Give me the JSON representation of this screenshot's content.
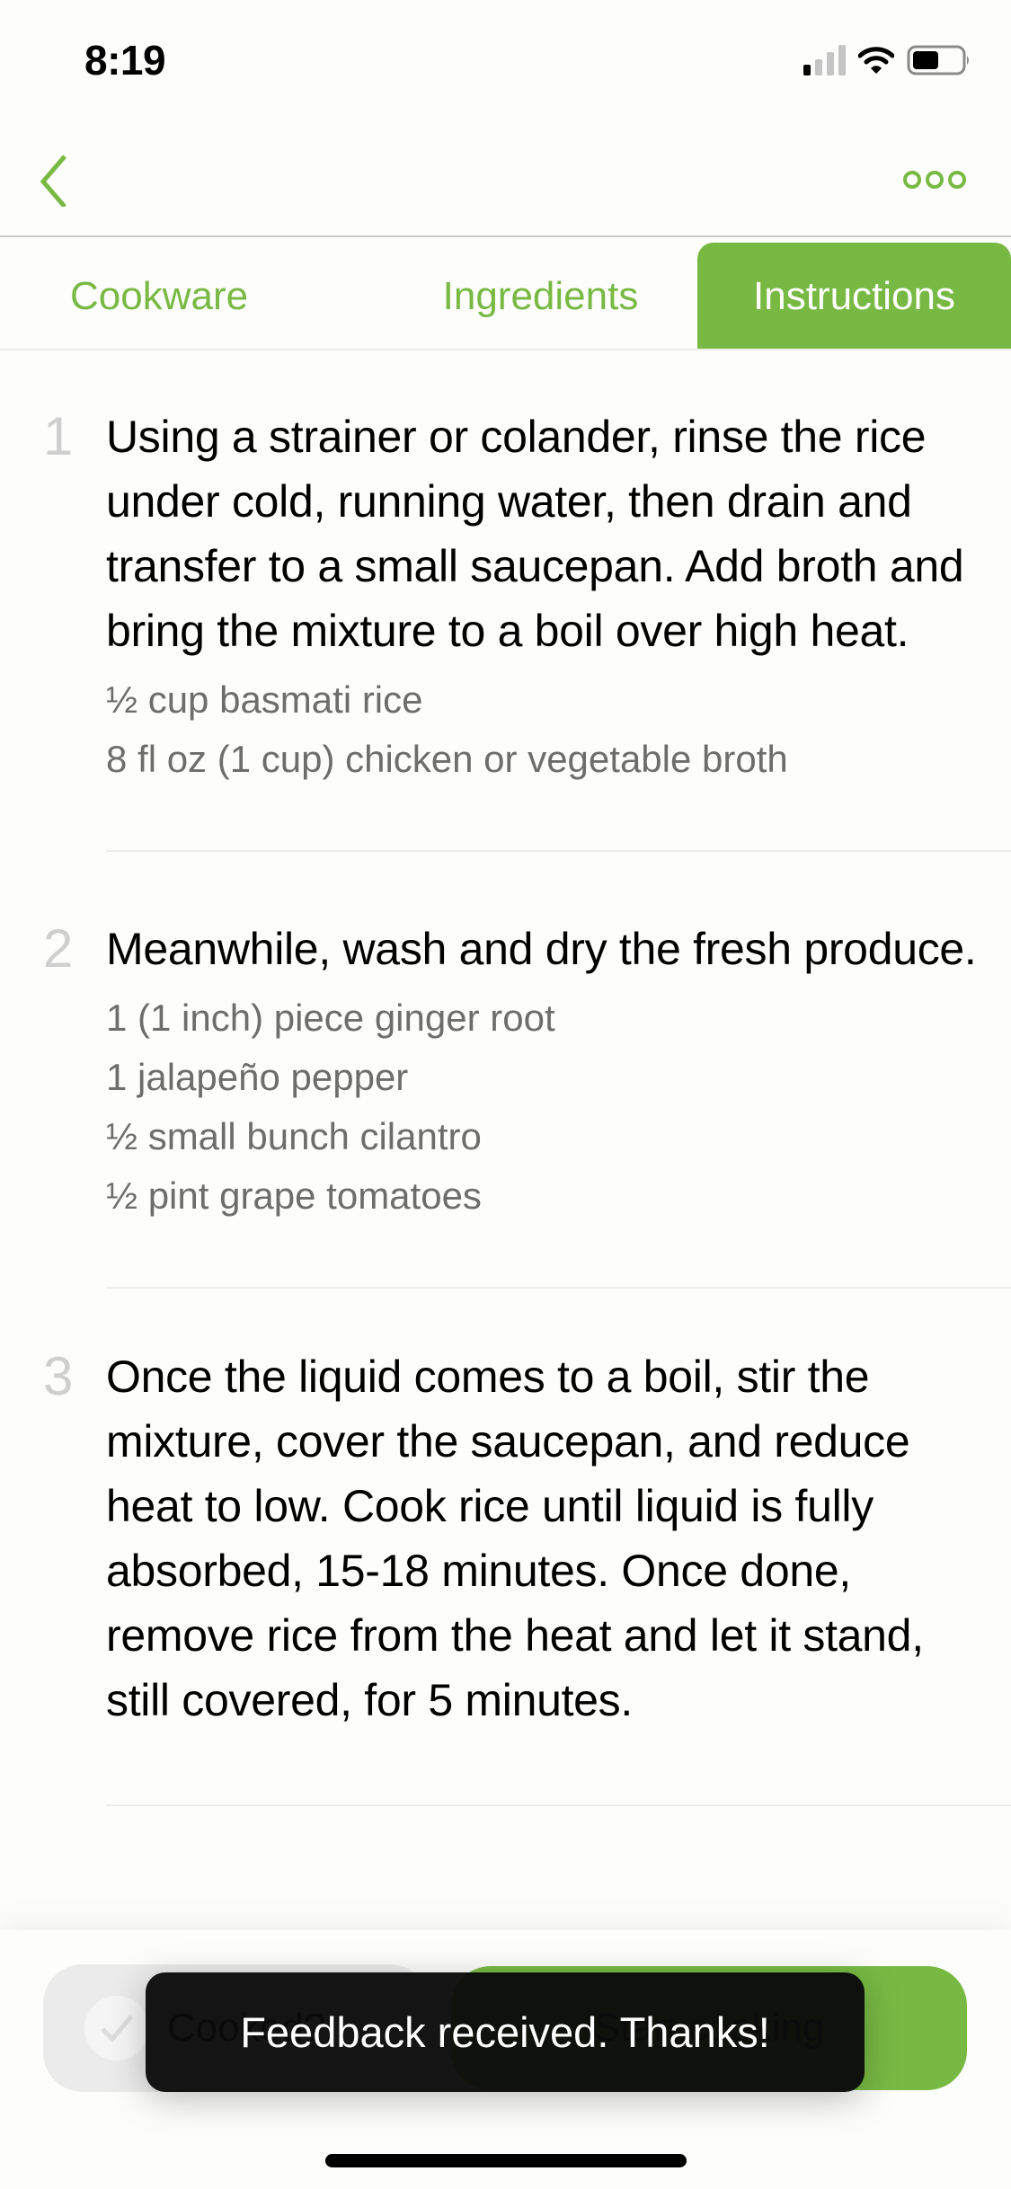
{
  "status_bar": {
    "time": "8:19",
    "signal_bars_active": 1,
    "signal_bars_total": 4,
    "battery_level": 0.5
  },
  "nav": {
    "back_icon": "chevron-left-icon",
    "more_icon": "more-options-icon"
  },
  "tabs": [
    {
      "label": "Cookware",
      "active": false
    },
    {
      "label": "Ingredients",
      "active": false
    },
    {
      "label": "Instructions",
      "active": true
    }
  ],
  "steps": [
    {
      "number": "1",
      "text": "Using a strainer or colander, rinse the rice under cold, running water, then drain and transfer to a small saucepan. Add broth and bring the mixture to a boil over high heat.",
      "ingredients": [
        "½ cup basmati rice",
        "8 fl oz (1 cup) chicken or vegetable broth"
      ]
    },
    {
      "number": "2",
      "text": "Meanwhile, wash and dry the fresh produce.",
      "ingredients": [
        "1 (1 inch) piece ginger root",
        "1 jalapeño pepper",
        "½ small bunch cilantro",
        "½ pint grape tomatoes"
      ]
    },
    {
      "number": "3",
      "text": "Once the liquid comes to a boil, stir the mixture, cover the saucepan, and reduce heat to low. Cook rice until liquid is fully absorbed, 15-18 minutes. Once done, remove rice from the heat and let it stand, still covered, for 5 minutes.",
      "ingredients": []
    }
  ],
  "bottom_bar": {
    "cooked_label": "Cooked?",
    "start_label": "Start cooking"
  },
  "toast": {
    "message": "Feedback received. Thanks!"
  },
  "colors": {
    "accent": "#78b943",
    "ingredient_text": "#6d6d6d",
    "step_number": "#cfcfcf"
  }
}
